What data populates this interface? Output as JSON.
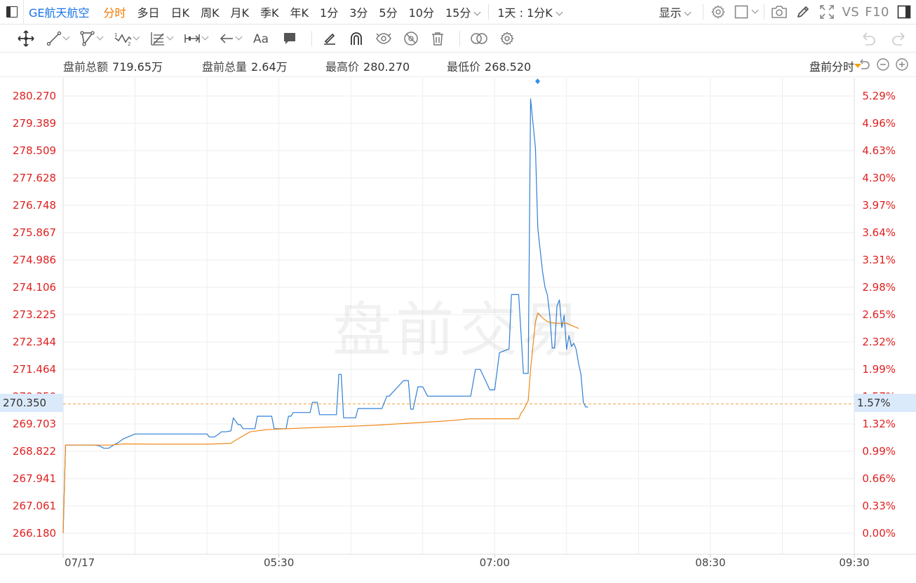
{
  "toolbar": {
    "symbol": "GE航天航空",
    "intervals": [
      "分时",
      "多日",
      "日K",
      "周K",
      "月K",
      "季K",
      "年K",
      "1分",
      "3分",
      "5分",
      "10分"
    ],
    "interval_15": "15分",
    "multi_interval": "1天 : 1分K",
    "display_label": "显示",
    "vs_label": "VS",
    "f10_label": "F10"
  },
  "stats": {
    "premarket_amount_label": "盘前总额",
    "premarket_amount": "719.65万",
    "premarket_volume_label": "盘前总量",
    "premarket_volume": "2.64万",
    "high_label": "最高价",
    "high": "280.270",
    "low_label": "最低价",
    "low": "268.520",
    "mode_label": "盘前分时"
  },
  "watermark": "盘前交易",
  "crosshair": {
    "price": "270.350",
    "percent": "1.57%"
  },
  "colors": {
    "price_line": "#2f7fd6",
    "avg_line": "#f08a1c",
    "axis_text": "#e02020",
    "active_tab": "#f07a00",
    "symbol": "#1a73e8",
    "crosshair": "#f0a040"
  },
  "chart_data": {
    "type": "line",
    "title": "",
    "xlabel": "",
    "ylabel": "",
    "ylim": [
      266.18,
      280.27
    ],
    "y_right_lim": [
      0.0,
      5.29
    ],
    "left_ticks": [
      "280.270",
      "279.389",
      "278.509",
      "277.628",
      "276.748",
      "275.867",
      "274.986",
      "274.106",
      "273.225",
      "272.344",
      "271.464",
      "270.350",
      "269.703",
      "268.822",
      "267.941",
      "267.061",
      "266.180"
    ],
    "right_ticks": [
      "5.29%",
      "4.96%",
      "4.63%",
      "4.30%",
      "3.97%",
      "3.64%",
      "3.31%",
      "2.98%",
      "2.65%",
      "2.32%",
      "1.99%",
      "1.57%",
      "1.32%",
      "0.99%",
      "0.66%",
      "0.33%",
      "0.00%"
    ],
    "x_ticks": [
      "07/17",
      "05:30",
      "07:00",
      "08:30",
      "09:30"
    ],
    "x_minutes_range": [
      240,
      570
    ],
    "grid": true,
    "series": [
      {
        "key": "price",
        "x": [
          240,
          241,
          253,
          255,
          257,
          259,
          261,
          263,
          265,
          270,
          300,
          301,
          303,
          305,
          306,
          308,
          310,
          311,
          313,
          314,
          315,
          320,
          321,
          323,
          327,
          328,
          333,
          334,
          335,
          336,
          343,
          344,
          346,
          347,
          354,
          355,
          356,
          357,
          362,
          363,
          372,
          373,
          375,
          376,
          382,
          384,
          385,
          386,
          388,
          390,
          392,
          400,
          402,
          404,
          410,
          412,
          414,
          418,
          420,
          422,
          426,
          427,
          430,
          432,
          434,
          435,
          437,
          438,
          440,
          441,
          442,
          443,
          444,
          445,
          446,
          447,
          448,
          449,
          450,
          451,
          452,
          453,
          454,
          455,
          456,
          457,
          458,
          459,
          460,
          461,
          462,
          463,
          464,
          465,
          466,
          467
        ],
        "y": [
          266.18,
          269.02,
          269.02,
          269.0,
          268.92,
          268.92,
          269.02,
          269.1,
          269.22,
          269.38,
          269.38,
          269.28,
          269.28,
          269.38,
          269.45,
          269.45,
          269.48,
          269.9,
          269.68,
          269.68,
          269.55,
          269.55,
          269.95,
          269.95,
          269.95,
          269.55,
          269.55,
          269.95,
          269.95,
          270.07,
          270.07,
          270.4,
          270.4,
          270.0,
          270.0,
          271.3,
          271.3,
          269.9,
          269.9,
          270.2,
          270.2,
          270.2,
          270.6,
          270.6,
          271.1,
          271.1,
          270.18,
          270.18,
          270.9,
          270.9,
          270.6,
          270.6,
          270.6,
          270.6,
          270.6,
          271.46,
          271.46,
          270.8,
          270.8,
          272.0,
          272.12,
          273.87,
          273.87,
          271.33,
          271.33,
          280.18,
          278.6,
          276.0,
          274.6,
          274.1,
          273.85,
          273.2,
          272.15,
          272.15,
          273.5,
          273.7,
          272.8,
          273.2,
          272.1,
          272.55,
          272.2,
          272.3,
          272.1,
          271.65,
          271.3,
          270.4,
          270.25,
          270.25,
          270.25,
          270.25,
          270.25,
          270.25,
          270.25,
          270.25,
          270.25,
          270.25
        ],
        "visible_points": 88
      },
      {
        "key": "avg",
        "x": [
          240,
          241,
          260,
          265,
          280,
          300,
          310,
          312,
          318,
          325,
          340,
          370,
          400,
          410,
          430,
          431,
          432,
          434,
          435,
          436,
          437,
          438,
          440,
          442,
          445,
          450,
          452,
          455
        ],
        "y": [
          266.18,
          269.02,
          269.02,
          269.06,
          269.05,
          269.05,
          269.08,
          269.18,
          269.45,
          269.52,
          269.57,
          269.66,
          269.8,
          269.87,
          269.87,
          270.05,
          270.15,
          270.45,
          271.46,
          272.25,
          273.0,
          273.28,
          273.12,
          273.0,
          272.95,
          272.95,
          272.88,
          272.78
        ]
      }
    ]
  }
}
